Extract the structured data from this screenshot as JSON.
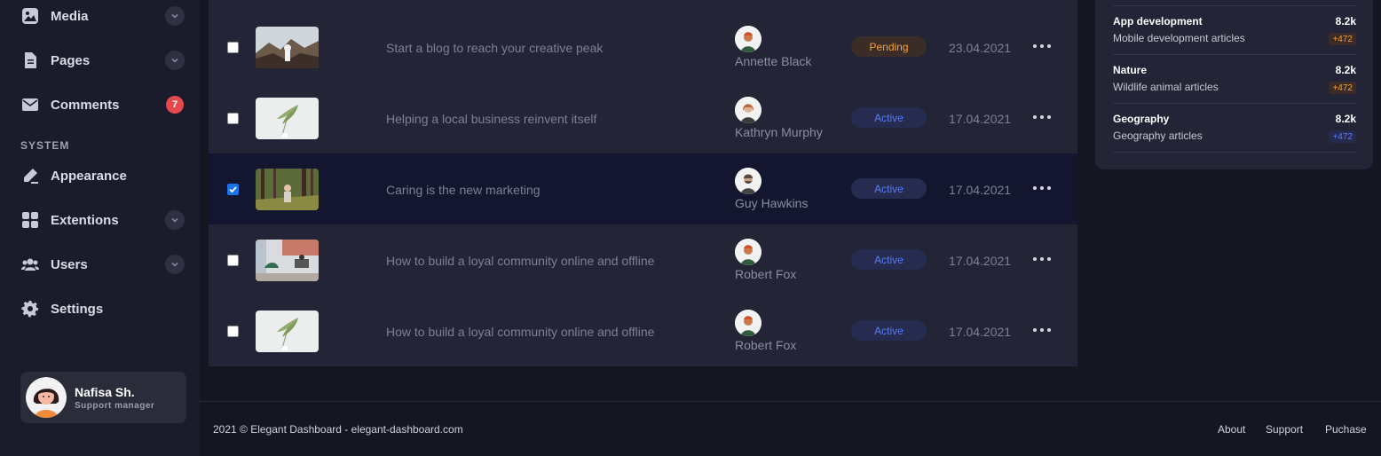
{
  "sidebar": {
    "items": [
      {
        "label": "Media",
        "icon": "image-icon",
        "has_chevron": true
      },
      {
        "label": "Pages",
        "icon": "document-icon",
        "has_chevron": true
      },
      {
        "label": "Comments",
        "icon": "mail-icon",
        "badge": "7"
      },
      {
        "label": "Appearance",
        "icon": "pen-icon"
      },
      {
        "label": "Extentions",
        "icon": "grid-icon",
        "has_chevron": true
      },
      {
        "label": "Users",
        "icon": "users-icon",
        "has_chevron": true
      },
      {
        "label": "Settings",
        "icon": "gear-icon"
      }
    ],
    "section_label": "SYSTEM",
    "user": {
      "name": "Nafisa Sh.",
      "role": "Support manager"
    }
  },
  "table": {
    "rows": [
      {
        "checked": false,
        "title": "Start a blog to reach your creative peak",
        "author": "Annette Black",
        "status": "Pending",
        "date": "23.04.2021"
      },
      {
        "checked": false,
        "title": "Helping a local business reinvent itself",
        "author": "Kathryn Murphy",
        "status": "Active",
        "date": "17.04.2021"
      },
      {
        "checked": true,
        "title": "Caring is the new marketing",
        "author": "Guy Hawkins",
        "status": "Active",
        "date": "17.04.2021"
      },
      {
        "checked": false,
        "title": "How to build a loyal community online and offline",
        "author": "Robert Fox",
        "status": "Active",
        "date": "17.04.2021"
      },
      {
        "checked": false,
        "title": "How to build a loyal community online and offline",
        "author": "Robert Fox",
        "status": "Active",
        "date": "17.04.2021"
      }
    ]
  },
  "widget": {
    "items": [
      {
        "title": "App development",
        "subtitle": "Mobile development articles",
        "value": "8.2k",
        "delta": "+472",
        "delta_color": "orange"
      },
      {
        "title": "Nature",
        "subtitle": "Wildlife animal articles",
        "value": "8.2k",
        "delta": "+472",
        "delta_color": "orange"
      },
      {
        "title": "Geography",
        "subtitle": "Geography articles",
        "value": "8.2k",
        "delta": "+472",
        "delta_color": "blue"
      }
    ]
  },
  "footer": {
    "copyright": "2021 © Elegant Dashboard - elegant-dashboard.com",
    "links": [
      "About",
      "Support",
      "Puchase"
    ]
  },
  "colors": {
    "accent_blue": "#5b7cf5",
    "accent_orange": "#f4a13a",
    "badge_red": "#e5484d"
  }
}
